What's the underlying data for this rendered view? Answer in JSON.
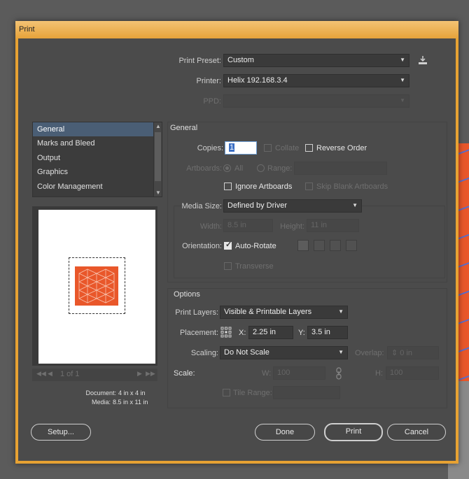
{
  "window": {
    "title": "Print"
  },
  "header": {
    "print_preset_label": "Print Preset:",
    "print_preset_value": "Custom",
    "printer_label": "Printer:",
    "printer_value": "Helix 192.168.3.4",
    "ppd_label": "PPD:",
    "ppd_value": ""
  },
  "sidebar": {
    "items": [
      {
        "label": "General",
        "selected": true
      },
      {
        "label": "Marks and Bleed"
      },
      {
        "label": "Output"
      },
      {
        "label": "Graphics"
      },
      {
        "label": "Color Management"
      }
    ]
  },
  "preview": {
    "page_nav": "1 of 1",
    "document_label": "Document:",
    "document_value": "4 in x 4 in",
    "media_label": "Media:",
    "media_value": "8.5 in x 11 in",
    "art_color": "#e9572a"
  },
  "general": {
    "section_title": "General",
    "copies_label": "Copies:",
    "copies_value": "1",
    "collate_label": "Collate",
    "reverse_order_label": "Reverse Order",
    "artboards_label": "Artboards:",
    "all_label": "All",
    "range_label": "Range:",
    "ignore_artboards_label": "Ignore Artboards",
    "skip_blank_label": "Skip Blank Artboards",
    "media_size_label": "Media Size:",
    "media_size_value": "Defined by Driver",
    "width_label": "Width:",
    "width_value": "8.5 in",
    "height_label": "Height:",
    "height_value": "11 in",
    "orientation_label": "Orientation:",
    "auto_rotate_label": "Auto-Rotate",
    "transverse_label": "Transverse"
  },
  "options": {
    "section_title": "Options",
    "print_layers_label": "Print Layers:",
    "print_layers_value": "Visible & Printable Layers",
    "placement_label": "Placement:",
    "x_label": "X:",
    "x_value": "2.25 in",
    "y_label": "Y:",
    "y_value": "3.5 in",
    "scaling_label": "Scaling:",
    "scaling_value": "Do Not Scale",
    "overlap_label": "Overlap:",
    "overlap_value": "0 in",
    "scale_label": "Scale:",
    "w_label": "W:",
    "w_value": "100",
    "h_label": "H:",
    "h_value": "100",
    "tile_range_label": "Tile Range:"
  },
  "footer": {
    "setup_label": "Setup...",
    "done_label": "Done",
    "print_label": "Print",
    "cancel_label": "Cancel"
  },
  "colors": {
    "title_bar": "#e6a33a",
    "dialog_bg": "#4b4b4b",
    "selected_item": "#4a5e75",
    "accent_art": "#e9572a"
  }
}
